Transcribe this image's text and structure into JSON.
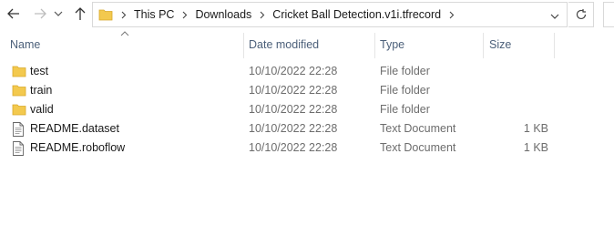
{
  "nav": {
    "back_icon": "arrow-left-icon",
    "forward_icon": "arrow-right-icon",
    "recent_icon": "chevron-down-icon",
    "up_icon": "arrow-up-icon"
  },
  "breadcrumb": [
    "This PC",
    "Downloads",
    "Cricket Ball Detection.v1i.tfrecord"
  ],
  "columns": {
    "name": "Name",
    "date": "Date modified",
    "type": "Type",
    "size": "Size"
  },
  "files": [
    {
      "name": "test",
      "date": "10/10/2022 22:28",
      "type": "File folder",
      "size": "",
      "icon": "folder-icon"
    },
    {
      "name": "train",
      "date": "10/10/2022 22:28",
      "type": "File folder",
      "size": "",
      "icon": "folder-icon"
    },
    {
      "name": "valid",
      "date": "10/10/2022 22:28",
      "type": "File folder",
      "size": "",
      "icon": "folder-icon"
    },
    {
      "name": "README.dataset",
      "date": "10/10/2022 22:28",
      "type": "Text Document",
      "size": "1 KB",
      "icon": "text-document-icon"
    },
    {
      "name": "README.roboflow",
      "date": "10/10/2022 22:28",
      "type": "Text Document",
      "size": "1 KB",
      "icon": "text-document-icon"
    }
  ],
  "colors": {
    "folder": "#f3c94e",
    "header_text": "#4c607a",
    "secondary_text": "#6d6d6d"
  }
}
